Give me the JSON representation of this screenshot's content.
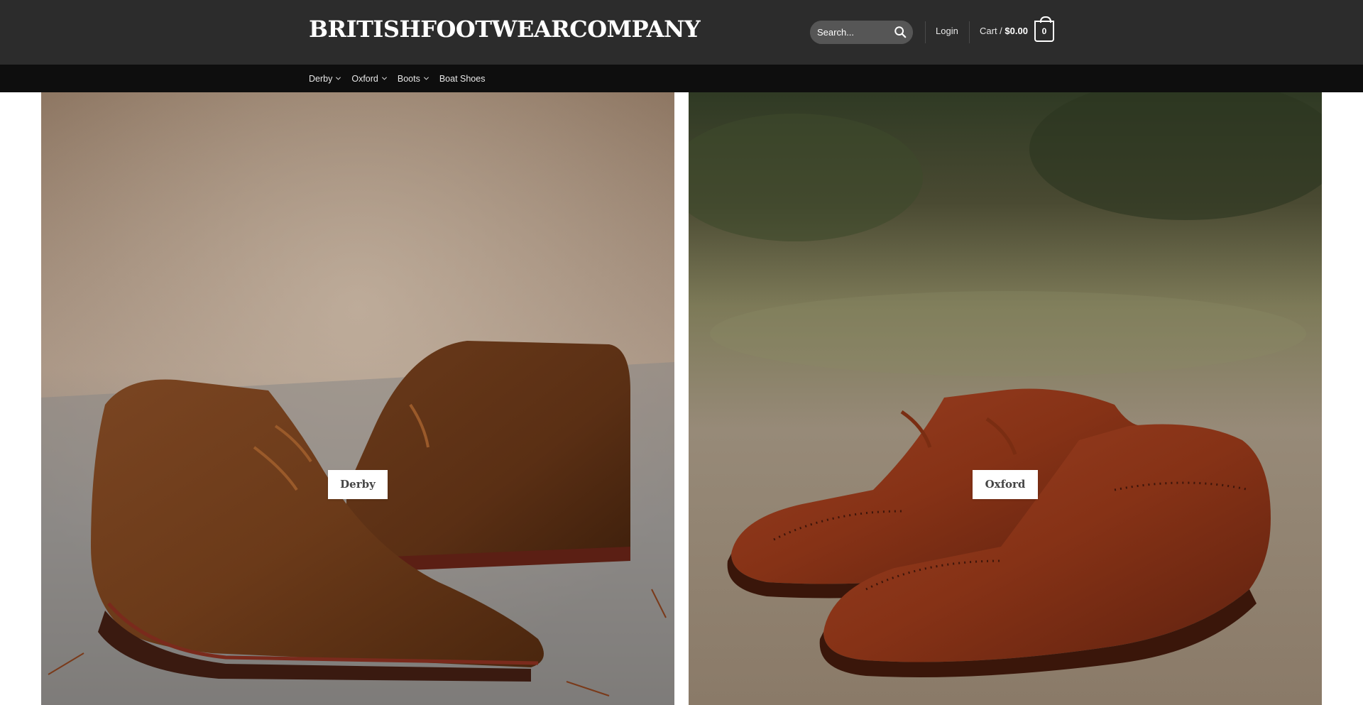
{
  "header": {
    "logo": "BRITISHFOOTWEARCOMPANY",
    "search": {
      "placeholder": "Search..."
    },
    "login_label": "Login",
    "cart": {
      "label": "Cart /",
      "total": "$0.00",
      "count": "0"
    }
  },
  "nav": {
    "items": [
      {
        "label": "Derby",
        "has_dropdown": true
      },
      {
        "label": "Oxford",
        "has_dropdown": true
      },
      {
        "label": "Boots",
        "has_dropdown": true
      },
      {
        "label": "Boat Shoes",
        "has_dropdown": false
      }
    ]
  },
  "categories": [
    {
      "label": "Derby"
    },
    {
      "label": "Oxford"
    }
  ],
  "colors": {
    "header_bg": "#2c2c2c",
    "nav_bg": "#0e0e0e",
    "text_light": "#ffffff"
  }
}
